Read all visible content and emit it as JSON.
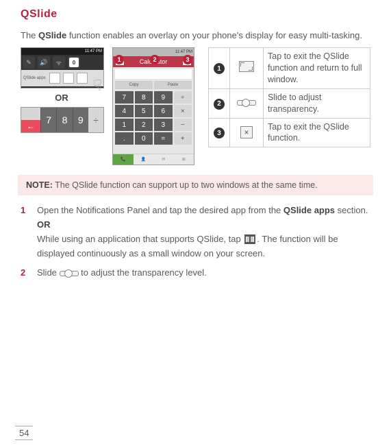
{
  "title": "QSlide",
  "intro": {
    "pre": "The ",
    "bold": "QSlide",
    "post": " function enables an overlay on your phone's display for easy multi-tasking."
  },
  "mock": {
    "time": "11:47 PM",
    "qslide_apps_label": "QSlide apps",
    "or": "OR",
    "keys": {
      "k7": "7",
      "k8": "8",
      "k9": "9",
      "kdiv": "÷",
      "back": "←"
    },
    "calc": {
      "title": "Calculator",
      "badge1": "1",
      "badge2": "2",
      "badge3": "3",
      "copy": "Copy",
      "paste": "Paste",
      "grid": [
        "7",
        "8",
        "9",
        "÷",
        "4",
        "5",
        "6",
        "×",
        "1",
        "2",
        "3",
        "−",
        ".",
        "0",
        "=",
        "+"
      ]
    }
  },
  "legend": {
    "rows": [
      {
        "num": "1",
        "iconType": "fullscreen",
        "text": "Tap to exit the QSlide function and return to full window."
      },
      {
        "num": "2",
        "iconType": "slider",
        "text": "Slide to adjust transparency."
      },
      {
        "num": "3",
        "iconType": "close",
        "text": "Tap to exit the QSlide function."
      }
    ]
  },
  "note": {
    "label": "NOTE:",
    "text": " The QSlide function can support up to two windows at the same time."
  },
  "steps": {
    "s1": {
      "num": "1",
      "line1_pre": "Open the Notifications Panel and tap the desired app from the ",
      "line1_bold": "QSlide apps",
      "line1_post": " section.",
      "or": "OR",
      "line2_pre": "While using an application that supports QSlide, tap ",
      "line2_post": ". The function will be displayed continuously as a small window on your screen."
    },
    "s2": {
      "num": "2",
      "pre": "Slide ",
      "post": " to adjust the transparency level."
    }
  },
  "pageNumber": "54"
}
